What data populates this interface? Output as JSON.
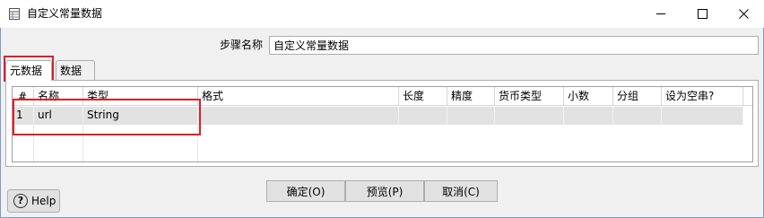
{
  "window": {
    "title": "自定义常量数据",
    "minimize_icon": "minimize-icon",
    "maximize_icon": "maximize-icon",
    "close_icon": "close-icon"
  },
  "step": {
    "label": "步骤名称",
    "value": "自定义常量数据"
  },
  "tabs": [
    {
      "label": "元数据",
      "active": true
    },
    {
      "label": "数据",
      "active": false
    }
  ],
  "table": {
    "columns": [
      "#",
      "名称",
      "类型",
      "格式",
      "长度",
      "精度",
      "货币类型",
      "小数",
      "分组",
      "设为空串?"
    ],
    "rows": [
      {
        "num": "1",
        "name": "url",
        "type": "String",
        "format": "",
        "length": "",
        "precision": "",
        "currency": "",
        "decimal": "",
        "group": "",
        "empty": ""
      }
    ]
  },
  "buttons": {
    "ok": "确定(O)",
    "preview": "预览(P)",
    "cancel": "取消(C)",
    "help": "Help"
  },
  "colors": {
    "annotation": "#e01f25",
    "selected_row": "#e2e2e2"
  }
}
